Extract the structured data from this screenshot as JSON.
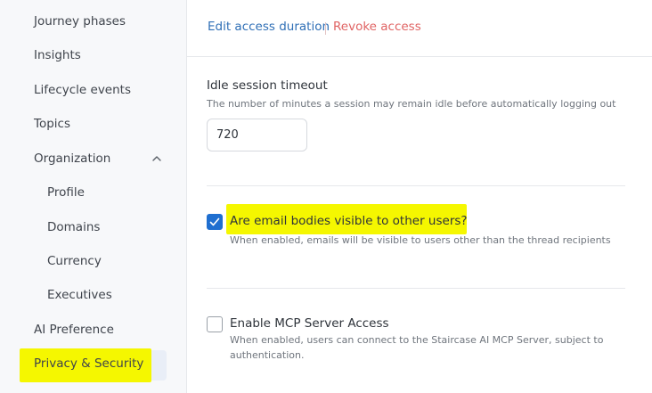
{
  "sidebar": {
    "items": [
      {
        "label": "Journey phases"
      },
      {
        "label": "Insights"
      },
      {
        "label": "Lifecycle events"
      },
      {
        "label": "Topics"
      },
      {
        "label": "Organization"
      },
      {
        "label": "Profile"
      },
      {
        "label": "Domains"
      },
      {
        "label": "Currency"
      },
      {
        "label": "Executives"
      },
      {
        "label": "AI Preference"
      },
      {
        "label": "Privacy & Security"
      }
    ]
  },
  "access": {
    "edit_label": "Edit access duration",
    "revoke_label": "Revoke access"
  },
  "idle": {
    "title": "Idle session timeout",
    "description": "The number of minutes a session may remain idle before automatically logging out",
    "value": "720"
  },
  "email_visibility": {
    "label": "Are email bodies visible to other users?",
    "description": "When enabled, emails will be visible to users other than the thread recipients",
    "checked": true
  },
  "mcp": {
    "label": "Enable MCP Server Access",
    "description_line1": "When enabled, users can connect to the Staircase AI MCP Server, subject to",
    "description_line2": "authentication.",
    "checked": false
  },
  "colors": {
    "accent": "#1f6fd0",
    "link": "#2f6fb6",
    "danger": "#e06464",
    "highlight": "#f5f700"
  }
}
